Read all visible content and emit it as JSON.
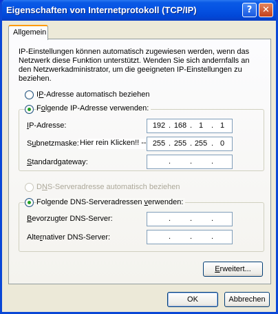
{
  "window": {
    "title": "Eigenschaften von Internetprotokoll (TCP/IP)",
    "help_glyph": "?",
    "close_glyph": "✕"
  },
  "tabs": [
    {
      "label": "Allgemein",
      "selected": true
    }
  ],
  "description": "IP-Einstellungen können automatisch zugewiesen werden, wenn das Netzwerk diese Funktion unterstützt. Wenden Sie sich andernfalls an den Netzwerkadministrator, um die geeigneten IP-Einstellungen zu beziehen.",
  "ip_mode": {
    "auto": {
      "pre": "I",
      "ul": "P",
      "post": "-Adresse automatisch beziehen",
      "selected": false
    },
    "manual": {
      "pre": "F",
      "ul": "o",
      "post": "lgende IP-Adresse verwenden:",
      "selected": true
    }
  },
  "ip_fields": {
    "ip_address": {
      "pre": "",
      "ul": "I",
      "post": "P-Adresse:",
      "octets": [
        "192",
        "168",
        "1",
        "1"
      ]
    },
    "subnet_mask": {
      "pre": "S",
      "ul": "u",
      "post": "bnetzmaske:",
      "octets": [
        "255",
        "255",
        "255",
        "0"
      ]
    },
    "gateway": {
      "pre": "",
      "ul": "S",
      "post": "tandardgateway:",
      "octets": [
        "",
        "",
        "",
        ""
      ]
    }
  },
  "annotation": "Hier rein Klicken!! -->",
  "dns_mode": {
    "auto": {
      "pre": "D",
      "ul": "N",
      "post": "S-Serveradresse automatisch beziehen",
      "selected": false,
      "disabled": true
    },
    "manual": {
      "pre": "Folgende DNS-Serveradressen ",
      "ul": "v",
      "post": "erwenden:",
      "selected": true
    }
  },
  "dns_fields": {
    "preferred": {
      "pre": "",
      "ul": "B",
      "post": "evorzugter DNS-Server:",
      "octets": [
        "",
        "",
        "",
        ""
      ]
    },
    "alternate": {
      "pre": "Alte",
      "ul": "r",
      "post": "nativer DNS-Server:",
      "octets": [
        "",
        "",
        "",
        ""
      ]
    }
  },
  "buttons": {
    "advanced": {
      "pre": "",
      "ul": "E",
      "post": "rweitert..."
    },
    "ok": "OK",
    "cancel": "Abbrechen"
  }
}
